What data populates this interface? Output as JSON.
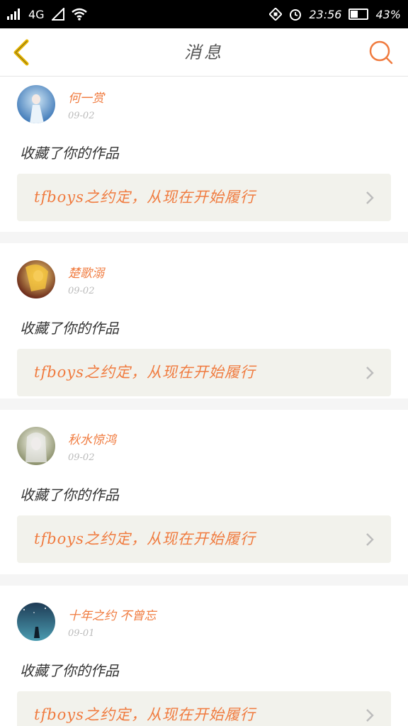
{
  "status_bar": {
    "network": "4G",
    "time": "23:56",
    "battery": "43%",
    "battery_level": 0.43
  },
  "header": {
    "title": "消息"
  },
  "colors": {
    "accent": "#f07b3f",
    "back_icon": "#e7b600",
    "card_work_bg": "#f2f2ec"
  },
  "messages": [
    {
      "user": "何一赏",
      "date": "09-02",
      "action": "收藏了你的作品",
      "work_title": "tfboys之约定，从现在开始履行",
      "avatar": "avatar-blue-figure"
    },
    {
      "user": "楚歌溺",
      "date": "09-02",
      "action": "收藏了你的作品",
      "work_title": "tfboys之约定，从现在开始履行",
      "avatar": "avatar-golden-hair"
    },
    {
      "user": "秋水惊鸿",
      "date": "09-02",
      "action": "收藏了你的作品",
      "work_title": "tfboys之约定，从现在开始履行",
      "avatar": "avatar-white-hair"
    },
    {
      "user": "十年之约 不曾忘",
      "date": "09-01",
      "action": "收藏了你的作品",
      "work_title": "tfboys之约定，从现在开始履行",
      "avatar": "avatar-night-sky"
    }
  ]
}
